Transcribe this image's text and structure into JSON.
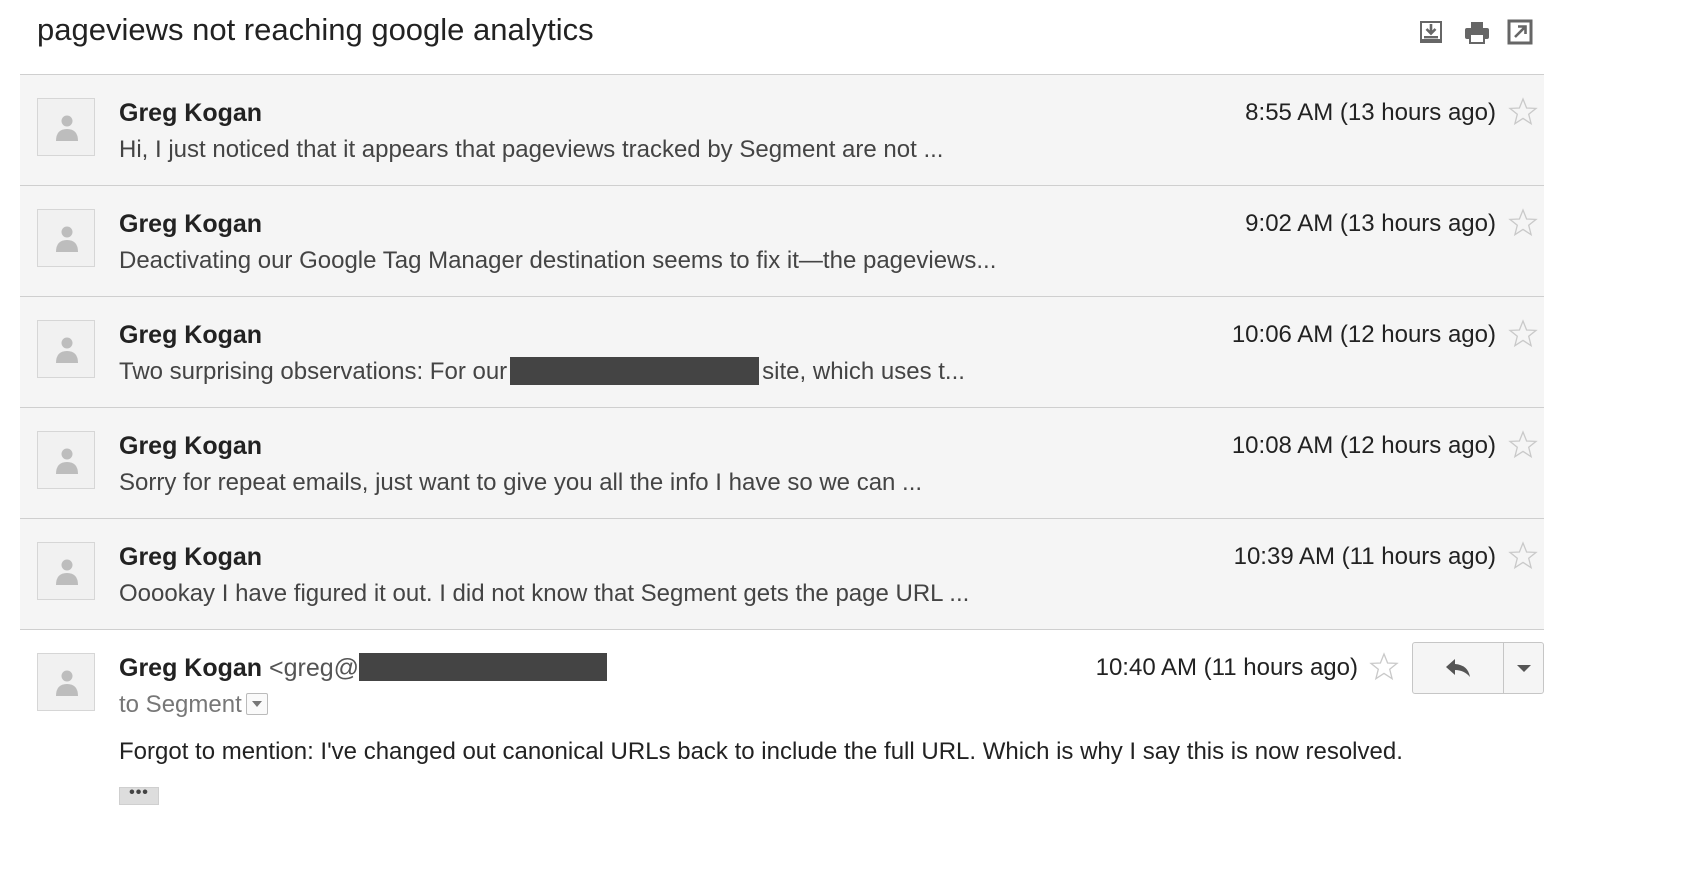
{
  "thread": {
    "subject": "pageviews not reaching google analytics"
  },
  "toolbar": {
    "icons": [
      "download-icon",
      "print-icon",
      "popout-icon"
    ]
  },
  "messages": [
    {
      "sender": "Greg Kogan",
      "snippet": "Hi, I just noticed that it appears that pageviews tracked by Segment are not ...",
      "time": "8:55 AM (13 hours ago)"
    },
    {
      "sender": "Greg Kogan",
      "snippet": "Deactivating our Google Tag Manager destination seems to fix it—the pageviews...",
      "time": "9:02 AM (13 hours ago)"
    },
    {
      "sender": "Greg Kogan",
      "snippet_before": "Two surprising observations: For our",
      "snippet_after": "site, which uses t...",
      "time": "10:06 AM (12 hours ago)"
    },
    {
      "sender": "Greg Kogan",
      "snippet": "Sorry for repeat emails, just want to give you all the info I have so we can ...",
      "time": "10:08 AM (12 hours ago)"
    },
    {
      "sender": "Greg Kogan",
      "snippet": "Ooookay I have figured it out. I did not know that Segment gets the page URL ...",
      "time": "10:39 AM (11 hours ago)"
    }
  ],
  "open_message": {
    "sender": "Greg Kogan",
    "email_prefix": "<greg@",
    "recipient": "to Segment",
    "time": "10:40 AM (11 hours ago)",
    "body": "Forgot to mention: I've changed out canonical URLs back to include the full URL. Which is why I say this is now resolved.",
    "ellipsis": "•••"
  },
  "colors": {
    "row_background": "#f5f5f5",
    "divider": "#cfcfcf",
    "redaction": "#444444"
  }
}
